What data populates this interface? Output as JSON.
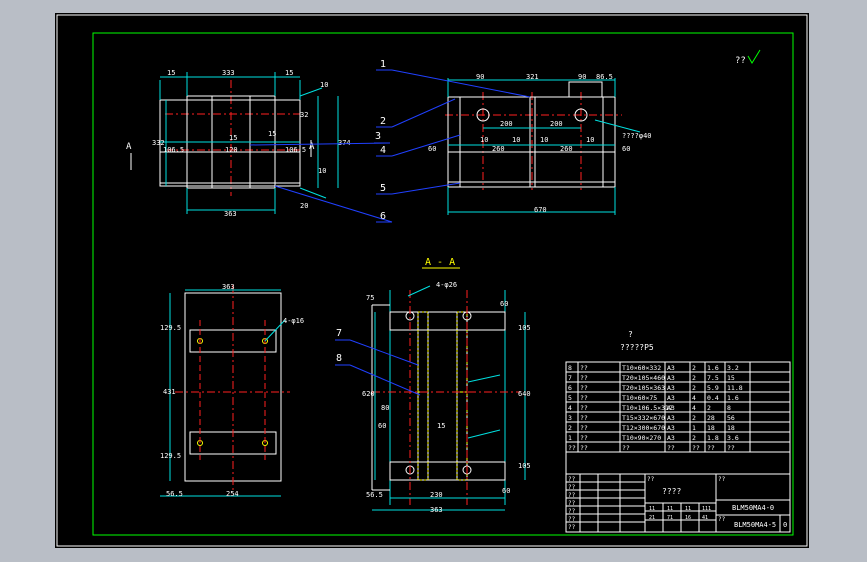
{
  "top_mark": "??",
  "views": {
    "front": {
      "dims_top": [
        "15",
        "333",
        "15"
      ],
      "dims_right": [
        "10",
        "32",
        "374",
        "10",
        "20"
      ],
      "dims_left": [
        "332"
      ],
      "dims_mid": [
        "15",
        "15",
        "106.5",
        "120",
        "106.5"
      ],
      "dims_bottom": [
        "363"
      ],
      "section_mark": "A"
    },
    "side": {
      "dims_top": [
        "90",
        "321",
        "90",
        "86.5"
      ],
      "dims_holes": [
        "200",
        "200"
      ],
      "hole_callout": "????φ40",
      "dims_mid": [
        "60",
        "10",
        "260",
        "10",
        "10",
        "260",
        "10",
        "60"
      ],
      "dims_bottom": [
        "670"
      ]
    },
    "section_title": "A - A",
    "section": {
      "hole_callout": "4-φ26 ",
      "dims_top": [
        "75",
        "60"
      ],
      "dims_right": [
        "105",
        "640",
        "105",
        "60"
      ],
      "dims_left": [
        "620",
        "80",
        "60",
        "15"
      ],
      "dims_bottom": [
        "56.5",
        "230",
        "363"
      ]
    },
    "bottom": {
      "dims_top": [
        "363"
      ],
      "hole_callout": "4-φ16",
      "dims_left": [
        "129.5",
        "431",
        "129.5"
      ],
      "dims_bottom": [
        "56.5",
        "254"
      ]
    }
  },
  "callouts": [
    "1",
    "2",
    "3",
    "4",
    "5",
    "6",
    "7",
    "8"
  ],
  "notes": [
    "?",
    "?????P5"
  ],
  "bom": [
    [
      "8",
      "??",
      "T10×60×332",
      "A3",
      "2",
      "1.6",
      "3.2"
    ],
    [
      "7",
      "??",
      "T20×105×460",
      "A3",
      "2",
      "7.5",
      "15"
    ],
    [
      "6",
      "??",
      "T20×105×363",
      "A3",
      "2",
      "5.9",
      "11.8"
    ],
    [
      "5",
      "??",
      "T10×60×75",
      "A3",
      "4",
      "0.4",
      "1.6"
    ],
    [
      "4",
      "??",
      "T10×106.5×312",
      "A3",
      "4",
      "2",
      "8"
    ],
    [
      "3",
      "??",
      "T15×332×670",
      "A3",
      "2",
      "28",
      "56"
    ],
    [
      "2",
      "??",
      "T12×300×670",
      "A3",
      "1",
      "18",
      "18"
    ],
    [
      "1",
      "??",
      "T10×90×270",
      "A3",
      "2",
      "1.8",
      "3.6"
    ]
  ],
  "bom_header": [
    "??",
    "??",
    "??",
    "??",
    "??",
    "??",
    "??"
  ],
  "title_block": {
    "name": "????",
    "drawing_no": "BLM50MA4-0",
    "drawing_no2": "BLM50MA4-5",
    "sheet": "0",
    "label_cells": [
      "??",
      "??",
      "??",
      "??",
      "??",
      "??",
      "??",
      "??",
      "??",
      "??"
    ],
    "mini": [
      "11",
      "11",
      "11",
      "111",
      "21",
      "71",
      "16",
      "41"
    ]
  },
  "colors": {
    "paper": "#000000",
    "border": "#ffffff",
    "frame": "#00ff00",
    "geometry": "#ffffff",
    "centerline": "#ff2020",
    "dimension": "#00e0e0",
    "leader": "#2040ff",
    "text": "#ffffff",
    "title": "#ffff00",
    "hatch": "#ffff00"
  }
}
